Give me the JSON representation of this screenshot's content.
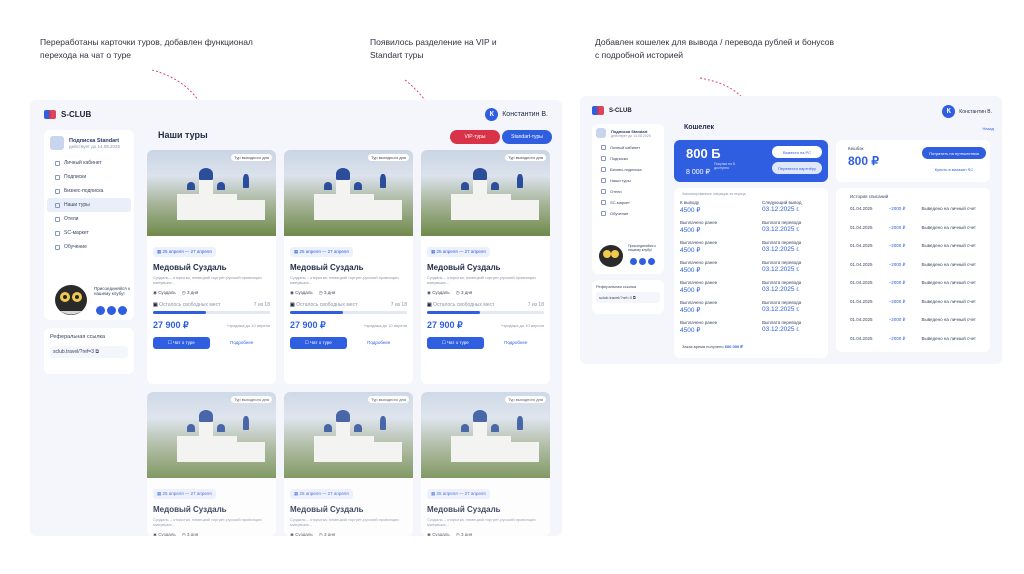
{
  "annotations": {
    "a1": "Переработаны карточки туров, добавлен функционал перехода на чат о туре",
    "a2": "Появилось разделение на VIP и Standart туры",
    "a3": "Добавлен кошелек для вывода / перевода рублей и бонусов с подробной историей"
  },
  "app": {
    "brand": "S-CLUB",
    "user": "Константин В.",
    "user_initial": "К"
  },
  "sidebar": {
    "sub_title": "Подписка Standart",
    "sub_sub": "действует до 14.08.2025",
    "items": [
      {
        "label": "Личный кабинет"
      },
      {
        "label": "Подписки"
      },
      {
        "label": "Бизнес-подписка"
      },
      {
        "label": "Наши туры"
      },
      {
        "label": "Отели"
      },
      {
        "label": "SC-маркет"
      },
      {
        "label": "Обучение"
      }
    ],
    "mascot_text": "Присоединяйся к нашему клубу!",
    "ref_label": "Реферальная ссылка",
    "ref_value": "sclub.travel/?ref=3"
  },
  "tours": {
    "title": "Наши туры",
    "vip": "VIP-туры",
    "standart": "Standart-туры",
    "card": {
      "tag": "Тур выходного дня",
      "dates": "25 апреля — 27 апреля",
      "title": "Медовый Суздаль",
      "desc": "Суздаль – открытка, немецкий торгрет-русский провинции минувших...",
      "city": "Суздаль",
      "days": "3 дня",
      "seats": "Осталось свободных мест",
      "seats_n": "7 из 18",
      "seats_frac": 0.45,
      "price": "27 900 ₽",
      "price_note": "*продажа до 10 апреля",
      "btn_chat": "Чат о туре",
      "btn_more": "Подробнее"
    }
  },
  "wallet": {
    "title": "Кошелек",
    "balance": "800 Б",
    "balance_sub": "8 000 ₽",
    "balance_note": "Покупки по Б\nдоступно",
    "btn_withdraw": "Вывести на РС",
    "btn_transfer": "Перевести партнёру",
    "cashback_label": "Кешбэк",
    "cashback": "800 ₽",
    "btn_travel": "Потратить на путешествия",
    "btn_buy": "Купить в магазин SC",
    "ops_header": "Запланированные операции за период",
    "ops": [
      {
        "l1": "К выводу",
        "v1": "4500 ₽",
        "l2": "Следующий вывод",
        "v2": "03.12.2025 г."
      },
      {
        "l1": "Выплачено ранее",
        "v1": "4500 ₽",
        "l2": "Выплата перевода",
        "v2": "03.12.2025 г."
      },
      {
        "l1": "Выплачено ранее",
        "v1": "4500 ₽",
        "l2": "Выплата перевода",
        "v2": "03.12.2025 г."
      },
      {
        "l1": "Выплачено ранее",
        "v1": "4500 ₽",
        "l2": "Выплата перевода",
        "v2": "03.12.2025 г."
      },
      {
        "l1": "Выплачено ранее",
        "v1": "4500 ₽",
        "l2": "Выплата перевода",
        "v2": "03.12.2025 г."
      },
      {
        "l1": "Выплачено ранее",
        "v1": "4500 ₽",
        "l2": "Выплата перевода",
        "v2": "03.12.2025 г."
      },
      {
        "l1": "Выплачено ранее",
        "v1": "4500 ₽",
        "l2": "Выплата перевода",
        "v2": "03.12.2025 г."
      }
    ],
    "ops_total_label": "Заказ время получено",
    "ops_total": "600 000 ₽",
    "history_title": "История списаний",
    "history": [
      {
        "date": "01.04.2025",
        "amount": "−2000 ₽",
        "desc": "Выведено на личный счет"
      },
      {
        "date": "01.04.2025",
        "amount": "−2000 ₽",
        "desc": "Выведено на личный счет"
      },
      {
        "date": "01.04.2025",
        "amount": "−2000 ₽",
        "desc": "Выведено на личный счет"
      },
      {
        "date": "01.04.2025",
        "amount": "−2000 ₽",
        "desc": "Выведено на личный счет"
      },
      {
        "date": "01.04.2025",
        "amount": "−2000 ₽",
        "desc": "Выведено на личный счет"
      },
      {
        "date": "01.04.2025",
        "amount": "−2000 ₽",
        "desc": "Выведено на личный счет"
      },
      {
        "date": "01.04.2025",
        "amount": "−2000 ₽",
        "desc": "Выведено на личный счет"
      },
      {
        "date": "01.04.2025",
        "amount": "−2000 ₽",
        "desc": "Выведено на личный счет"
      }
    ],
    "back": "Назад",
    "sidebar": {
      "sub_title": "Подписка Standart",
      "sub_sub": "действует до 14.08.2025",
      "items": [
        {
          "label": "Личный кабинет"
        },
        {
          "label": "Подписки"
        },
        {
          "label": "Бизнес-подписка"
        },
        {
          "label": "Наши туры"
        },
        {
          "label": "Отели"
        },
        {
          "label": "SC-маркет"
        },
        {
          "label": "Обучение"
        }
      ],
      "mascot_text": "Присоединяйся к нашему клубу!",
      "ref_label": "Реферальная ссылка",
      "ref_value": "sclub.travel/?ref=3"
    }
  }
}
